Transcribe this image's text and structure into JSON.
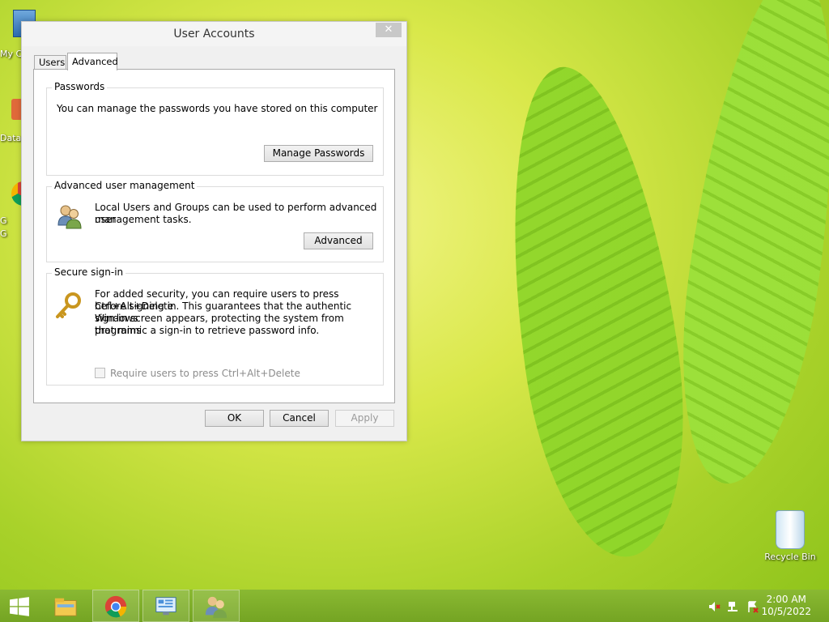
{
  "desktop": {
    "left_edge_labels": [
      "My C",
      "Data",
      "G",
      "G"
    ],
    "recycle_bin_label": "Recycle Bin"
  },
  "dialog": {
    "title": "User Accounts",
    "close_glyph": "✕",
    "tabs": [
      {
        "label": "Users",
        "selected": false
      },
      {
        "label": "Advanced",
        "selected": true
      }
    ],
    "passwords": {
      "legend": "Passwords",
      "text": "You can manage the passwords you have stored on this computer",
      "button": "Manage Passwords"
    },
    "advanced_management": {
      "legend": "Advanced user management",
      "text_line1": "Local Users and Groups can be used to perform advanced user",
      "text_line2": "management tasks.",
      "button": "Advanced"
    },
    "secure_signin": {
      "legend": "Secure sign-in",
      "text_lines": [
        "For added security, you can require users to press Ctrl+Alt+Delete",
        "before signing in. This guarantees that the authentic Windows",
        "sign-in screen appears, protecting the system from programs",
        "that mimic a sign-in to retrieve password info."
      ],
      "checkbox_label": "Require users to press Ctrl+Alt+Delete",
      "checkbox_checked": false,
      "checkbox_enabled": false
    },
    "buttons": {
      "ok": "OK",
      "cancel": "Cancel",
      "apply": "Apply"
    }
  },
  "taskbar": {
    "items": [
      "start-button",
      "file-explorer-icon",
      "chrome-icon",
      "control-panel-icon",
      "user-accounts-icon"
    ],
    "clock_time": "2:00 AM",
    "clock_date": "10/5/2022"
  }
}
